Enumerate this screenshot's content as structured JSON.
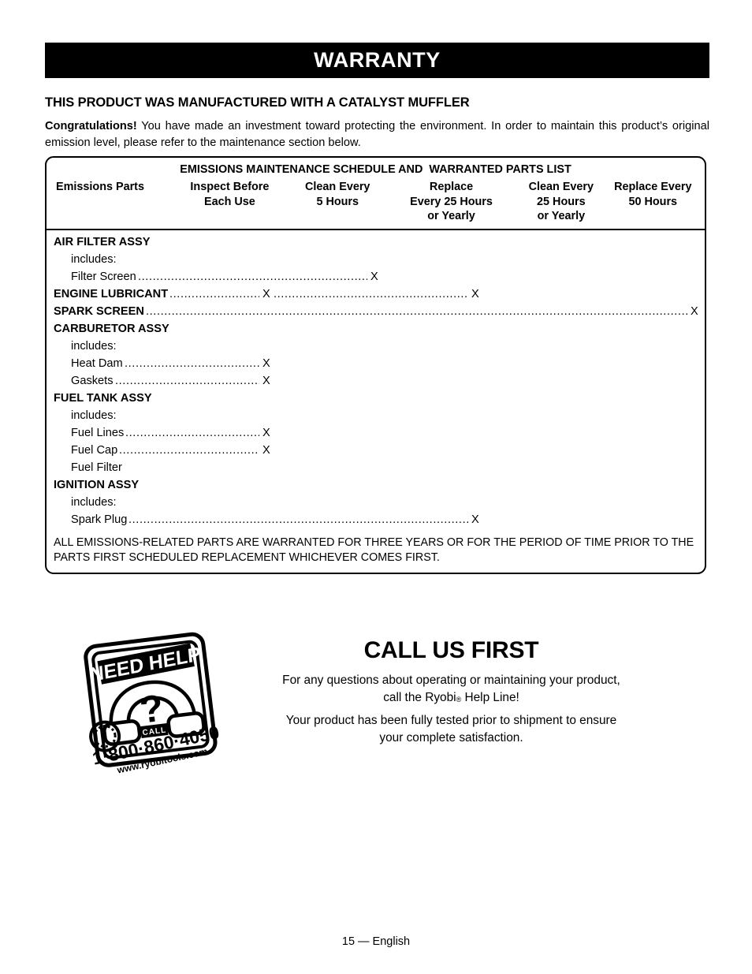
{
  "banner": {
    "title": "WARRANTY"
  },
  "intro": {
    "heading": "THIS PRODUCT WAS MANUFACTURED WITH A CATALYST MUFFLER",
    "lead": "Congratulations!",
    "body": " You have made an investment toward protecting the environment. In order to maintain this product’s original emission level, please refer to the maintenance section below."
  },
  "table": {
    "title": "EMISSIONS MAINTENANCE SCHEDULE AND  WARRANTED PARTS LIST",
    "columns": [
      "Emissions Parts",
      "Inspect Before\nEach Use",
      "Clean Every\n5 Hours",
      "Replace\nEvery 25 Hours\nor Yearly",
      "Clean Every\n25 Hours\nor Yearly",
      "Replace Every\n50 Hours"
    ],
    "rows": [
      {
        "label": "AIR FILTER ASSY",
        "bold": true,
        "indent": false,
        "marks": []
      },
      {
        "label": "includes:",
        "bold": false,
        "indent": true,
        "marks": []
      },
      {
        "label": "Filter Screen",
        "bold": false,
        "indent": true,
        "marks": [
          {
            "column": 3,
            "value": "X"
          }
        ]
      },
      {
        "label": "ENGINE LUBRICANT",
        "bold": true,
        "indent": false,
        "marks": [
          {
            "column": 2,
            "value": "X"
          },
          {
            "column": 4,
            "value": "X"
          }
        ]
      },
      {
        "label": "SPARK SCREEN",
        "bold": true,
        "indent": false,
        "marks": [
          {
            "column": 6,
            "value": "X"
          }
        ]
      },
      {
        "label": "CARBURETOR ASSY",
        "bold": true,
        "indent": false,
        "marks": []
      },
      {
        "label": "includes:",
        "bold": false,
        "indent": true,
        "marks": []
      },
      {
        "label": "Heat Dam",
        "bold": false,
        "indent": true,
        "marks": [
          {
            "column": 2,
            "value": "X"
          }
        ]
      },
      {
        "label": "Gaskets",
        "bold": false,
        "indent": true,
        "marks": [
          {
            "column": 2,
            "value": "X"
          }
        ]
      },
      {
        "label": "FUEL TANK ASSY",
        "bold": true,
        "indent": false,
        "marks": []
      },
      {
        "label": "includes:",
        "bold": false,
        "indent": true,
        "marks": []
      },
      {
        "label": "Fuel Lines",
        "bold": false,
        "indent": true,
        "marks": [
          {
            "column": 2,
            "value": "X"
          }
        ]
      },
      {
        "label": "Fuel Cap",
        "bold": false,
        "indent": true,
        "marks": [
          {
            "column": 2,
            "value": "X"
          }
        ]
      },
      {
        "label": "Fuel Filter",
        "bold": false,
        "indent": true,
        "marks": []
      },
      {
        "label": "IGNITION ASSY",
        "bold": true,
        "indent": false,
        "marks": []
      },
      {
        "label": "includes:",
        "bold": false,
        "indent": true,
        "marks": []
      },
      {
        "label": "Spark Plug",
        "bold": false,
        "indent": true,
        "marks": [
          {
            "column": 4,
            "value": "X"
          }
        ]
      }
    ],
    "disclaimer": "ALL EMISSIONS-RELATED PARTS ARE WARRANTED FOR THREE YEARS OR FOR THE PERIOD OF TIME PRIOR TO THE PARTS FIRST SCHEDULED REPLACEMENT WHICHEVER COMES FIRST."
  },
  "badge": {
    "headline": "NEED HELP",
    "question_mark": "?",
    "call_label": "CALL",
    "phone": "1·800·860·4050",
    "website": "www.ryobitools.com"
  },
  "call_us": {
    "title": "CALL US FIRST",
    "line1": "For any questions about operating or maintaining your product,",
    "line2_pre": "call the Ryobi",
    "line2_mark": "®",
    "line2_post": " Help Line!",
    "line3": "Your product has been fully tested prior to shipment to ensure",
    "line4": "your complete satisfaction."
  },
  "footer": {
    "text": "15 — English"
  }
}
